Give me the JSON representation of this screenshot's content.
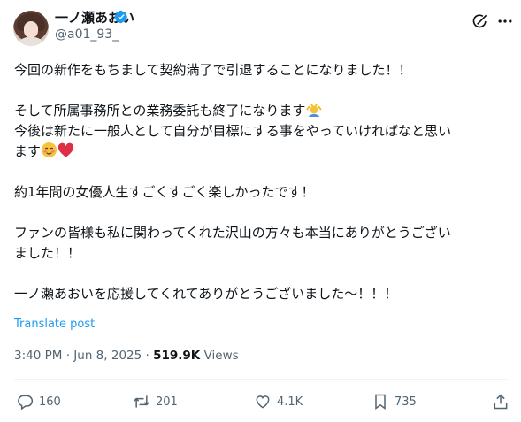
{
  "author": {
    "name": "一ノ瀬あおい",
    "handle": "@a01_93_"
  },
  "tweet": {
    "lines": [
      "今回の新作をもちまして契約満了で引退することになりました！！",
      "",
      "そして所属事務所との業務委託も終了になります",
      "今後は新たに一般人として自分が目標にする事をやっていければなと思い",
      "ます",
      "",
      "約1年間の女優人生すごくすごく楽しかったです！",
      "",
      "ファンの皆様も私に関わってくれた沢山の方々も本当にありがとうござい",
      "ました！！",
      "",
      "一ノ瀬あおいを応援してくれてありがとうございました〜！！！"
    ],
    "translate_label": "Translate post",
    "time": "3:40 PM",
    "date": "Jun 8, 2025",
    "separator": "·",
    "views": "519.9K",
    "views_label": "Views"
  },
  "actions": {
    "replies": "160",
    "reposts": "201",
    "likes": "4.1K",
    "bookmarks": "735"
  },
  "colors": {
    "accent": "#1d9bf0",
    "secondary_text": "#536471",
    "primary_text": "#0f1419"
  }
}
